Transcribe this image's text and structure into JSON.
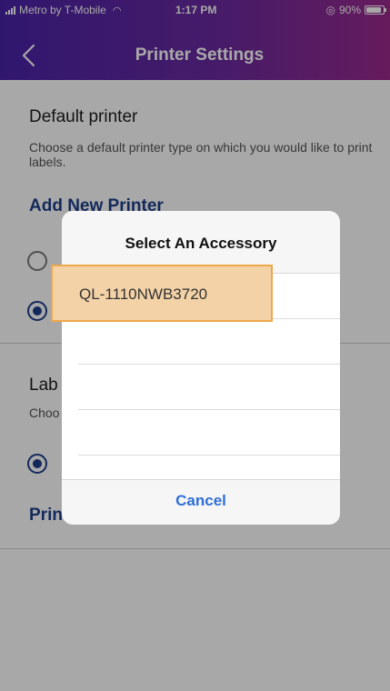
{
  "status_bar": {
    "carrier": "Metro by T-Mobile",
    "time": "1:17 PM",
    "battery": "90%"
  },
  "nav": {
    "title": "Printer Settings"
  },
  "sections": {
    "default_printer": {
      "title": "Default printer",
      "description": "Choose a default printer type on which you would like to print labels.",
      "add_link": "Add New Printer"
    },
    "label_section": {
      "title_visible": "Lab",
      "description_visible": "Choo"
    },
    "print_link_visible": "Prin"
  },
  "modal": {
    "title": "Select An Accessory",
    "options": [
      "QL-1110NWB3720"
    ],
    "cancel_label": "Cancel"
  },
  "colors": {
    "header_start": "#4a23a8",
    "header_end": "#9a2a8c",
    "link": "#1f3f8a",
    "cancel": "#2e6fd6",
    "highlight_fill": "#f2d2a6",
    "highlight_border": "#eea84a"
  }
}
